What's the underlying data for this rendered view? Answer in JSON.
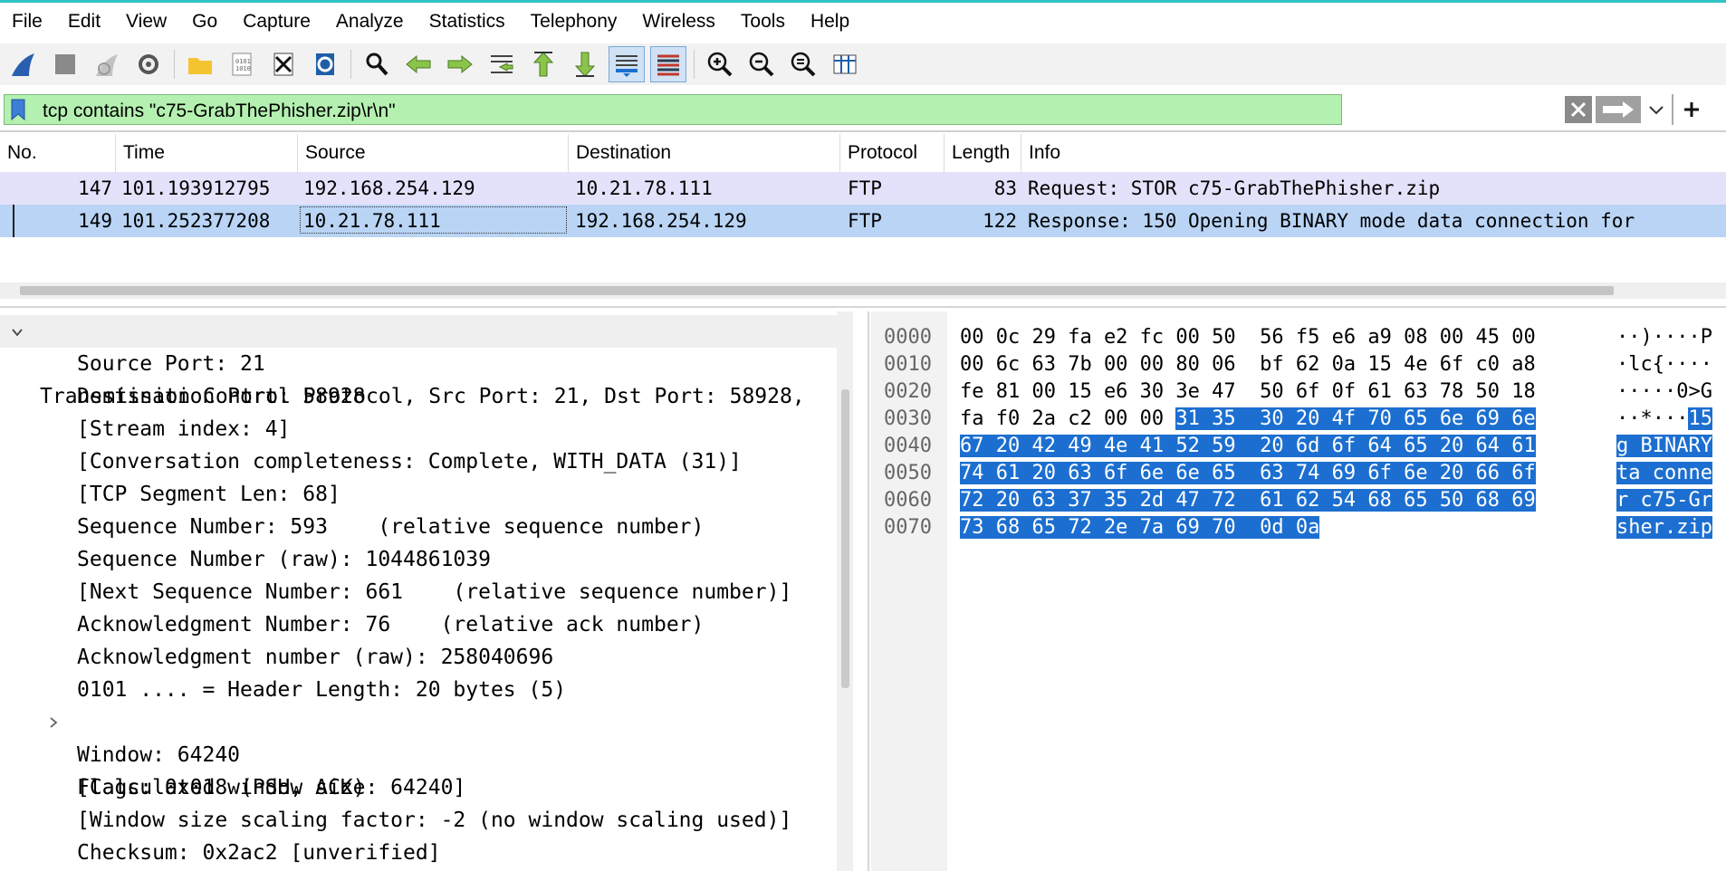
{
  "menu": [
    "File",
    "Edit",
    "View",
    "Go",
    "Capture",
    "Analyze",
    "Statistics",
    "Telephony",
    "Wireless",
    "Tools",
    "Help"
  ],
  "toolbar_icons": [
    "shark-fin-start-icon",
    "stop-square-icon",
    "restart-fin-icon",
    "capture-options-gear-icon",
    "open-folder-icon",
    "save-file-icon",
    "close-file-icon",
    "reload-icon",
    "find-magnifier-icon",
    "go-back-arrow-icon",
    "go-forward-arrow-icon",
    "go-to-packet-icon",
    "go-first-arrow-icon",
    "go-last-arrow-icon",
    "autoscroll-icon",
    "colorize-icon",
    "zoom-in-icon",
    "zoom-out-icon",
    "normal-size-icon",
    "resize-columns-icon"
  ],
  "filter": {
    "text": "tcp contains \"c75-GrabThePhisher.zip\\r\\n\"",
    "bg_color": "#b4f0b0"
  },
  "columns": [
    "No.",
    "Time",
    "Source",
    "Destination",
    "Protocol",
    "Length",
    "Info"
  ],
  "packets": [
    {
      "no": "147",
      "time": "101.193912795",
      "source": "192.168.254.129",
      "destination": "10.21.78.111",
      "protocol": "FTP",
      "length": "83",
      "info": "Request: STOR c75-GrabThePhisher.zip"
    },
    {
      "no": "149",
      "time": "101.252377208",
      "source": "10.21.78.111",
      "destination": "192.168.254.129",
      "protocol": "FTP",
      "length": "122",
      "info": "Response: 150 Opening BINARY mode data connection for"
    }
  ],
  "details": {
    "header": "Transmission Control Protocol, Src Port: 21, Dst Port: 58928,",
    "lines": [
      "Source Port: 21",
      "Destination Port: 58928",
      "[Stream index: 4]",
      "[Conversation completeness: Complete, WITH_DATA (31)]",
      "[TCP Segment Len: 68]",
      "Sequence Number: 593    (relative sequence number)",
      "Sequence Number (raw): 1044861039",
      "[Next Sequence Number: 661    (relative sequence number)]",
      "Acknowledgment Number: 76    (relative ack number)",
      "Acknowledgment number (raw): 258040696",
      "0101 .... = Header Length: 20 bytes (5)",
      "Flags: 0x018 (PSH, ACK)",
      "Window: 64240",
      "[Calculated window size: 64240]",
      "[Window size scaling factor: -2 (no window scaling used)]",
      "Checksum: 0x2ac2 [unverified]"
    ]
  },
  "bytes": [
    {
      "offset": "0000",
      "pre": "00 0c 29 fa e2 fc 00 50  56 f5 e6 a9 08 00 45 00",
      "sel": "",
      "ascii_pre": "··)····P",
      "ascii_sel": ""
    },
    {
      "offset": "0010",
      "pre": "00 6c 63 7b 00 00 80 06  bf 62 0a 15 4e 6f c0 a8",
      "sel": "",
      "ascii_pre": "·lc{····",
      "ascii_sel": ""
    },
    {
      "offset": "0020",
      "pre": "fe 81 00 15 e6 30 3e 47  50 6f 0f 61 63 78 50 18",
      "sel": "",
      "ascii_pre": "·····0>G",
      "ascii_sel": ""
    },
    {
      "offset": "0030",
      "pre": "fa f0 2a c2 00 00 ",
      "sel": "31 35  30 20 4f 70 65 6e 69 6e",
      "ascii_pre": "··*···",
      "ascii_sel": "15"
    },
    {
      "offset": "0040",
      "pre": "",
      "sel": "67 20 42 49 4e 41 52 59  20 6d 6f 64 65 20 64 61",
      "ascii_pre": "",
      "ascii_sel": "g BINARY"
    },
    {
      "offset": "0050",
      "pre": "",
      "sel": "74 61 20 63 6f 6e 6e 65  63 74 69 6f 6e 20 66 6f",
      "ascii_pre": "",
      "ascii_sel": "ta conne"
    },
    {
      "offset": "0060",
      "pre": "",
      "sel": "72 20 63 37 35 2d 47 72  61 62 54 68 65 50 68 69",
      "ascii_pre": "",
      "ascii_sel": "r c75-Gr"
    },
    {
      "offset": "0070",
      "pre": "",
      "sel": "73 68 65 72 2e 7a 69 70  0d 0a",
      "ascii_pre": "",
      "ascii_sel": "sher.zip"
    }
  ],
  "colors": {
    "row_request": "#e4e2fa",
    "row_selected": "#b9d4f5",
    "byte_selection": "#1c6fd0"
  }
}
